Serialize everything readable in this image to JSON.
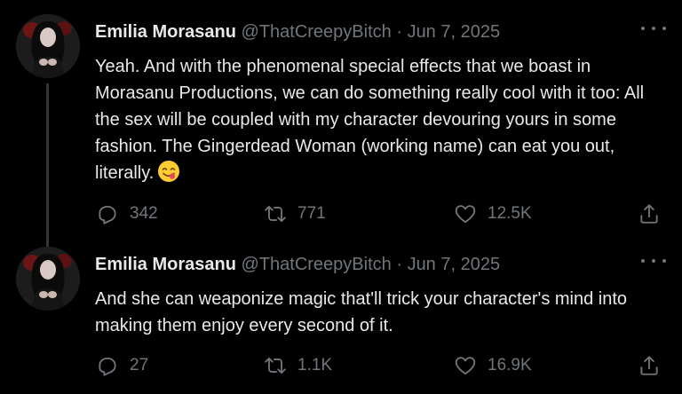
{
  "tweets": [
    {
      "author_name": "Emilia Morasanu",
      "handle": "@ThatCreepyBitch",
      "separator": "·",
      "date": "Jun 7, 2025",
      "text": "Yeah. And with the phenomenal special effects that we boast in Morasanu Productions, we can do something really cool with it too: All the sex will be coupled with my character devouring yours in some fashion. The Gingerdead Woman (working name) can eat you out, literally.",
      "emoji": "face-savoring-food",
      "replies": "342",
      "retweets": "771",
      "likes": "12.5K"
    },
    {
      "author_name": "Emilia Morasanu",
      "handle": "@ThatCreepyBitch",
      "separator": "·",
      "date": "Jun 7, 2025",
      "text": "And she can weaponize magic that'll trick your character's mind into making them enjoy every second of it.",
      "replies": "27",
      "retweets": "1.1K",
      "likes": "16.9K"
    }
  ],
  "colors": {
    "background": "#000000",
    "primary_text": "#e7e9ea",
    "secondary_text": "#71767b",
    "thread_line": "#333639"
  }
}
